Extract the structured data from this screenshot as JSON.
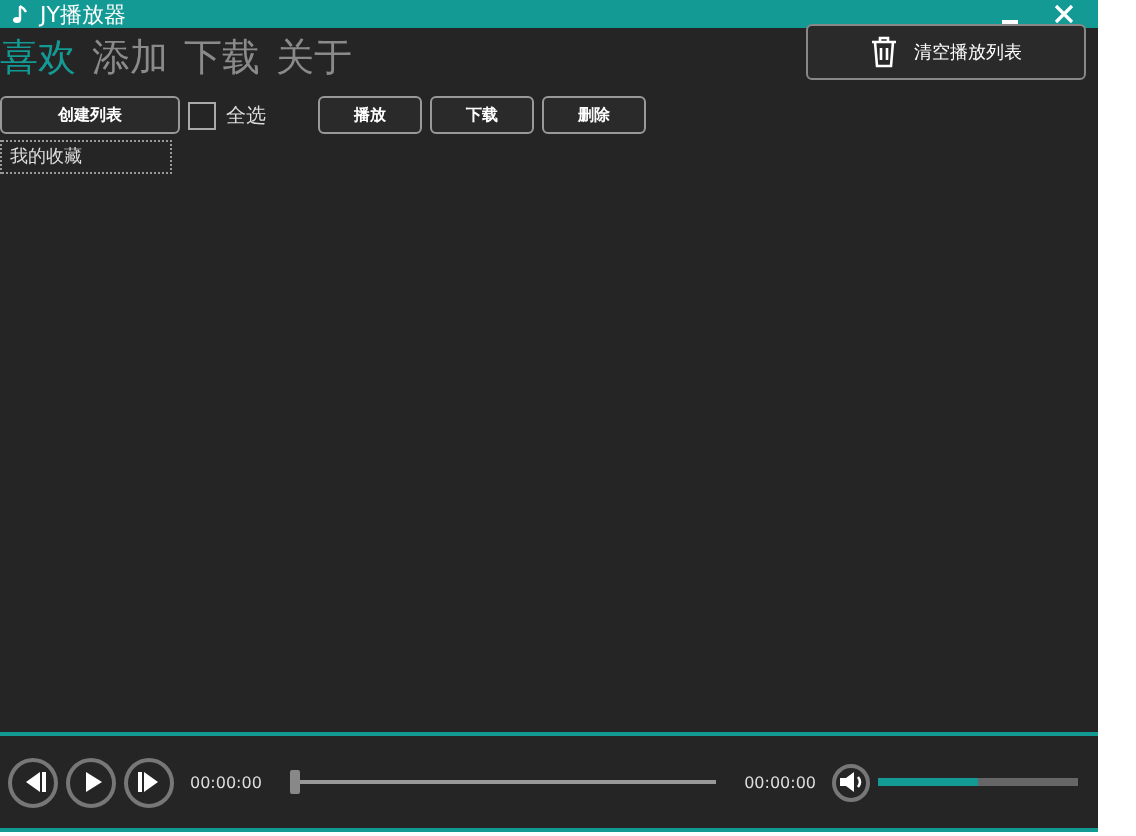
{
  "window": {
    "title": "JY播放器"
  },
  "tabs": [
    {
      "label": "喜欢",
      "selected": true
    },
    {
      "label": "添加",
      "selected": false
    },
    {
      "label": "下载",
      "selected": false
    },
    {
      "label": "关于",
      "selected": false
    }
  ],
  "clear_button": {
    "label": "清空播放列表"
  },
  "toolbar": {
    "create_button": "创建列表",
    "select_all": {
      "label": "全选",
      "checked": false
    },
    "buttons": [
      "播放",
      "下载",
      "删除"
    ]
  },
  "playlists": [
    {
      "name": "我的收藏",
      "selected": true
    }
  ],
  "player": {
    "elapsed": "00:00:00",
    "duration": "00:00:00",
    "progress": {
      "level": 0
    },
    "volume": {
      "level": 0.5
    }
  }
}
